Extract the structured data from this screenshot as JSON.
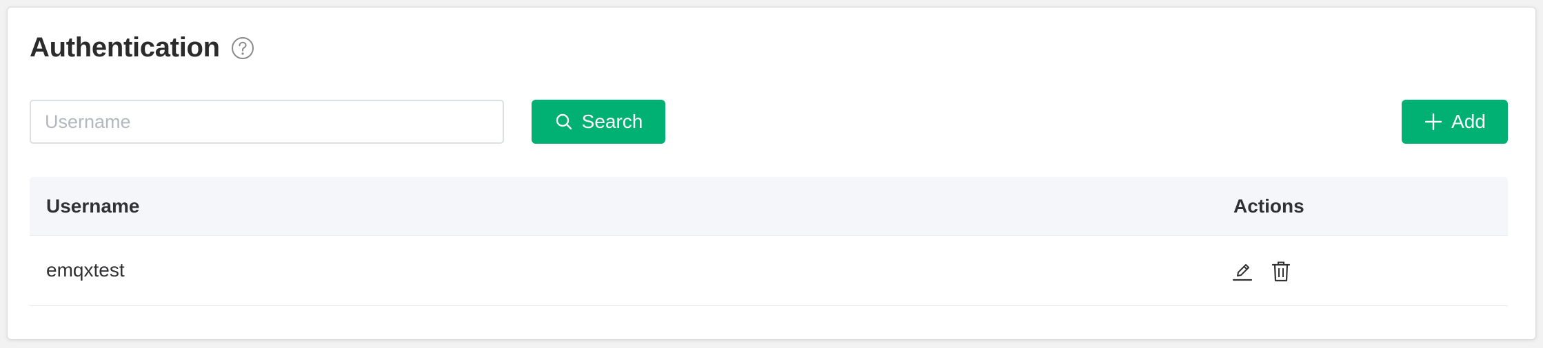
{
  "header": {
    "title": "Authentication",
    "help_icon": "question-circle-icon"
  },
  "toolbar": {
    "search_placeholder": "Username",
    "search_value": "",
    "search_label": "Search",
    "search_icon": "search-icon",
    "add_label": "Add",
    "add_icon": "plus-icon"
  },
  "table": {
    "columns": [
      "Username",
      "Actions"
    ],
    "rows": [
      {
        "username": "emqxtest",
        "actions": [
          "edit-icon",
          "delete-icon"
        ]
      }
    ]
  },
  "colors": {
    "primary": "#00b173",
    "header_bg": "#f5f6f9",
    "text": "#303133",
    "placeholder": "#b4b7bd"
  }
}
